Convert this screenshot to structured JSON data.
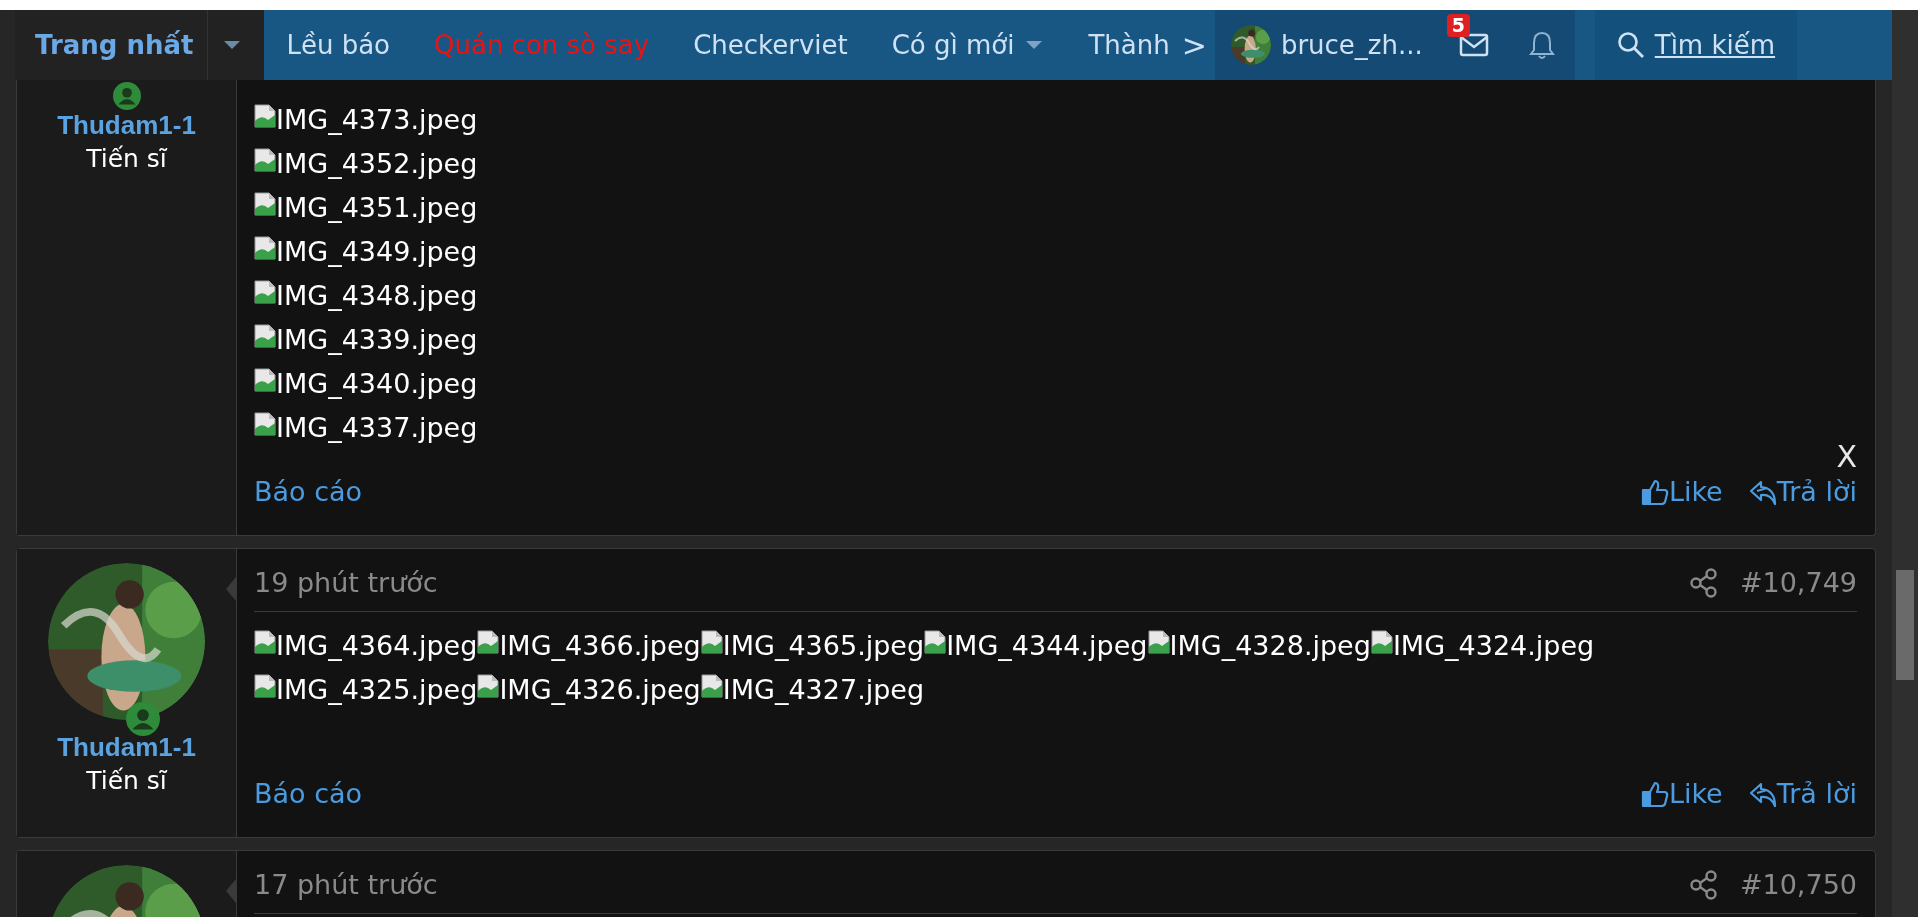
{
  "nav": {
    "items": [
      {
        "label": "Trang nhất",
        "selected": true,
        "has_menu": true
      },
      {
        "label": "Lều báo",
        "selected": false,
        "has_menu": false
      },
      {
        "label": "Quán con sò say",
        "selected": false,
        "has_menu": false,
        "color": "#e81313"
      },
      {
        "label": "Checkerviet",
        "selected": false,
        "has_menu": false
      },
      {
        "label": "Có gì mới",
        "selected": false,
        "has_menu": true
      },
      {
        "label": "Thành",
        "selected": false,
        "has_menu": false
      }
    ],
    "scroll_arrow": ">",
    "user": {
      "name": "bruce_zh..."
    },
    "inbox_badge": "5",
    "search": {
      "label": "Tìm kiếm"
    }
  },
  "posts": [
    {
      "author": "Thudam1-1",
      "title": "Tiến sĩ",
      "avatar_visible": false,
      "image_rows": [
        [
          "IMG_4373.jpeg"
        ],
        [
          "IMG_4352.jpeg"
        ],
        [
          "IMG_4351.jpeg"
        ],
        [
          "IMG_4349.jpeg"
        ],
        [
          "IMG_4348.jpeg"
        ],
        [
          "IMG_4339.jpeg"
        ],
        [
          "IMG_4340.jpeg"
        ],
        [
          "IMG_4337.jpeg"
        ]
      ],
      "report": "Báo cáo",
      "like": "Like",
      "reply": "Trả lời",
      "close_mark": "X"
    },
    {
      "author": "Thudam1-1",
      "title": "Tiến sĩ",
      "avatar_visible": true,
      "time": "19 phút trước",
      "number": "#10,749",
      "image_rows": [
        [
          "IMG_4364.jpeg",
          "IMG_4366.jpeg",
          "IMG_4365.jpeg",
          "IMG_4344.jpeg",
          "IMG_4328.jpeg",
          "IMG_4324.jpeg"
        ],
        [
          "IMG_4325.jpeg",
          "IMG_4326.jpeg",
          "IMG_4327.jpeg"
        ]
      ],
      "report": "Báo cáo",
      "like": "Like",
      "reply": "Trả lời"
    },
    {
      "avatar_visible": true,
      "time": "17 phút trước",
      "number": "#10,750"
    }
  ]
}
